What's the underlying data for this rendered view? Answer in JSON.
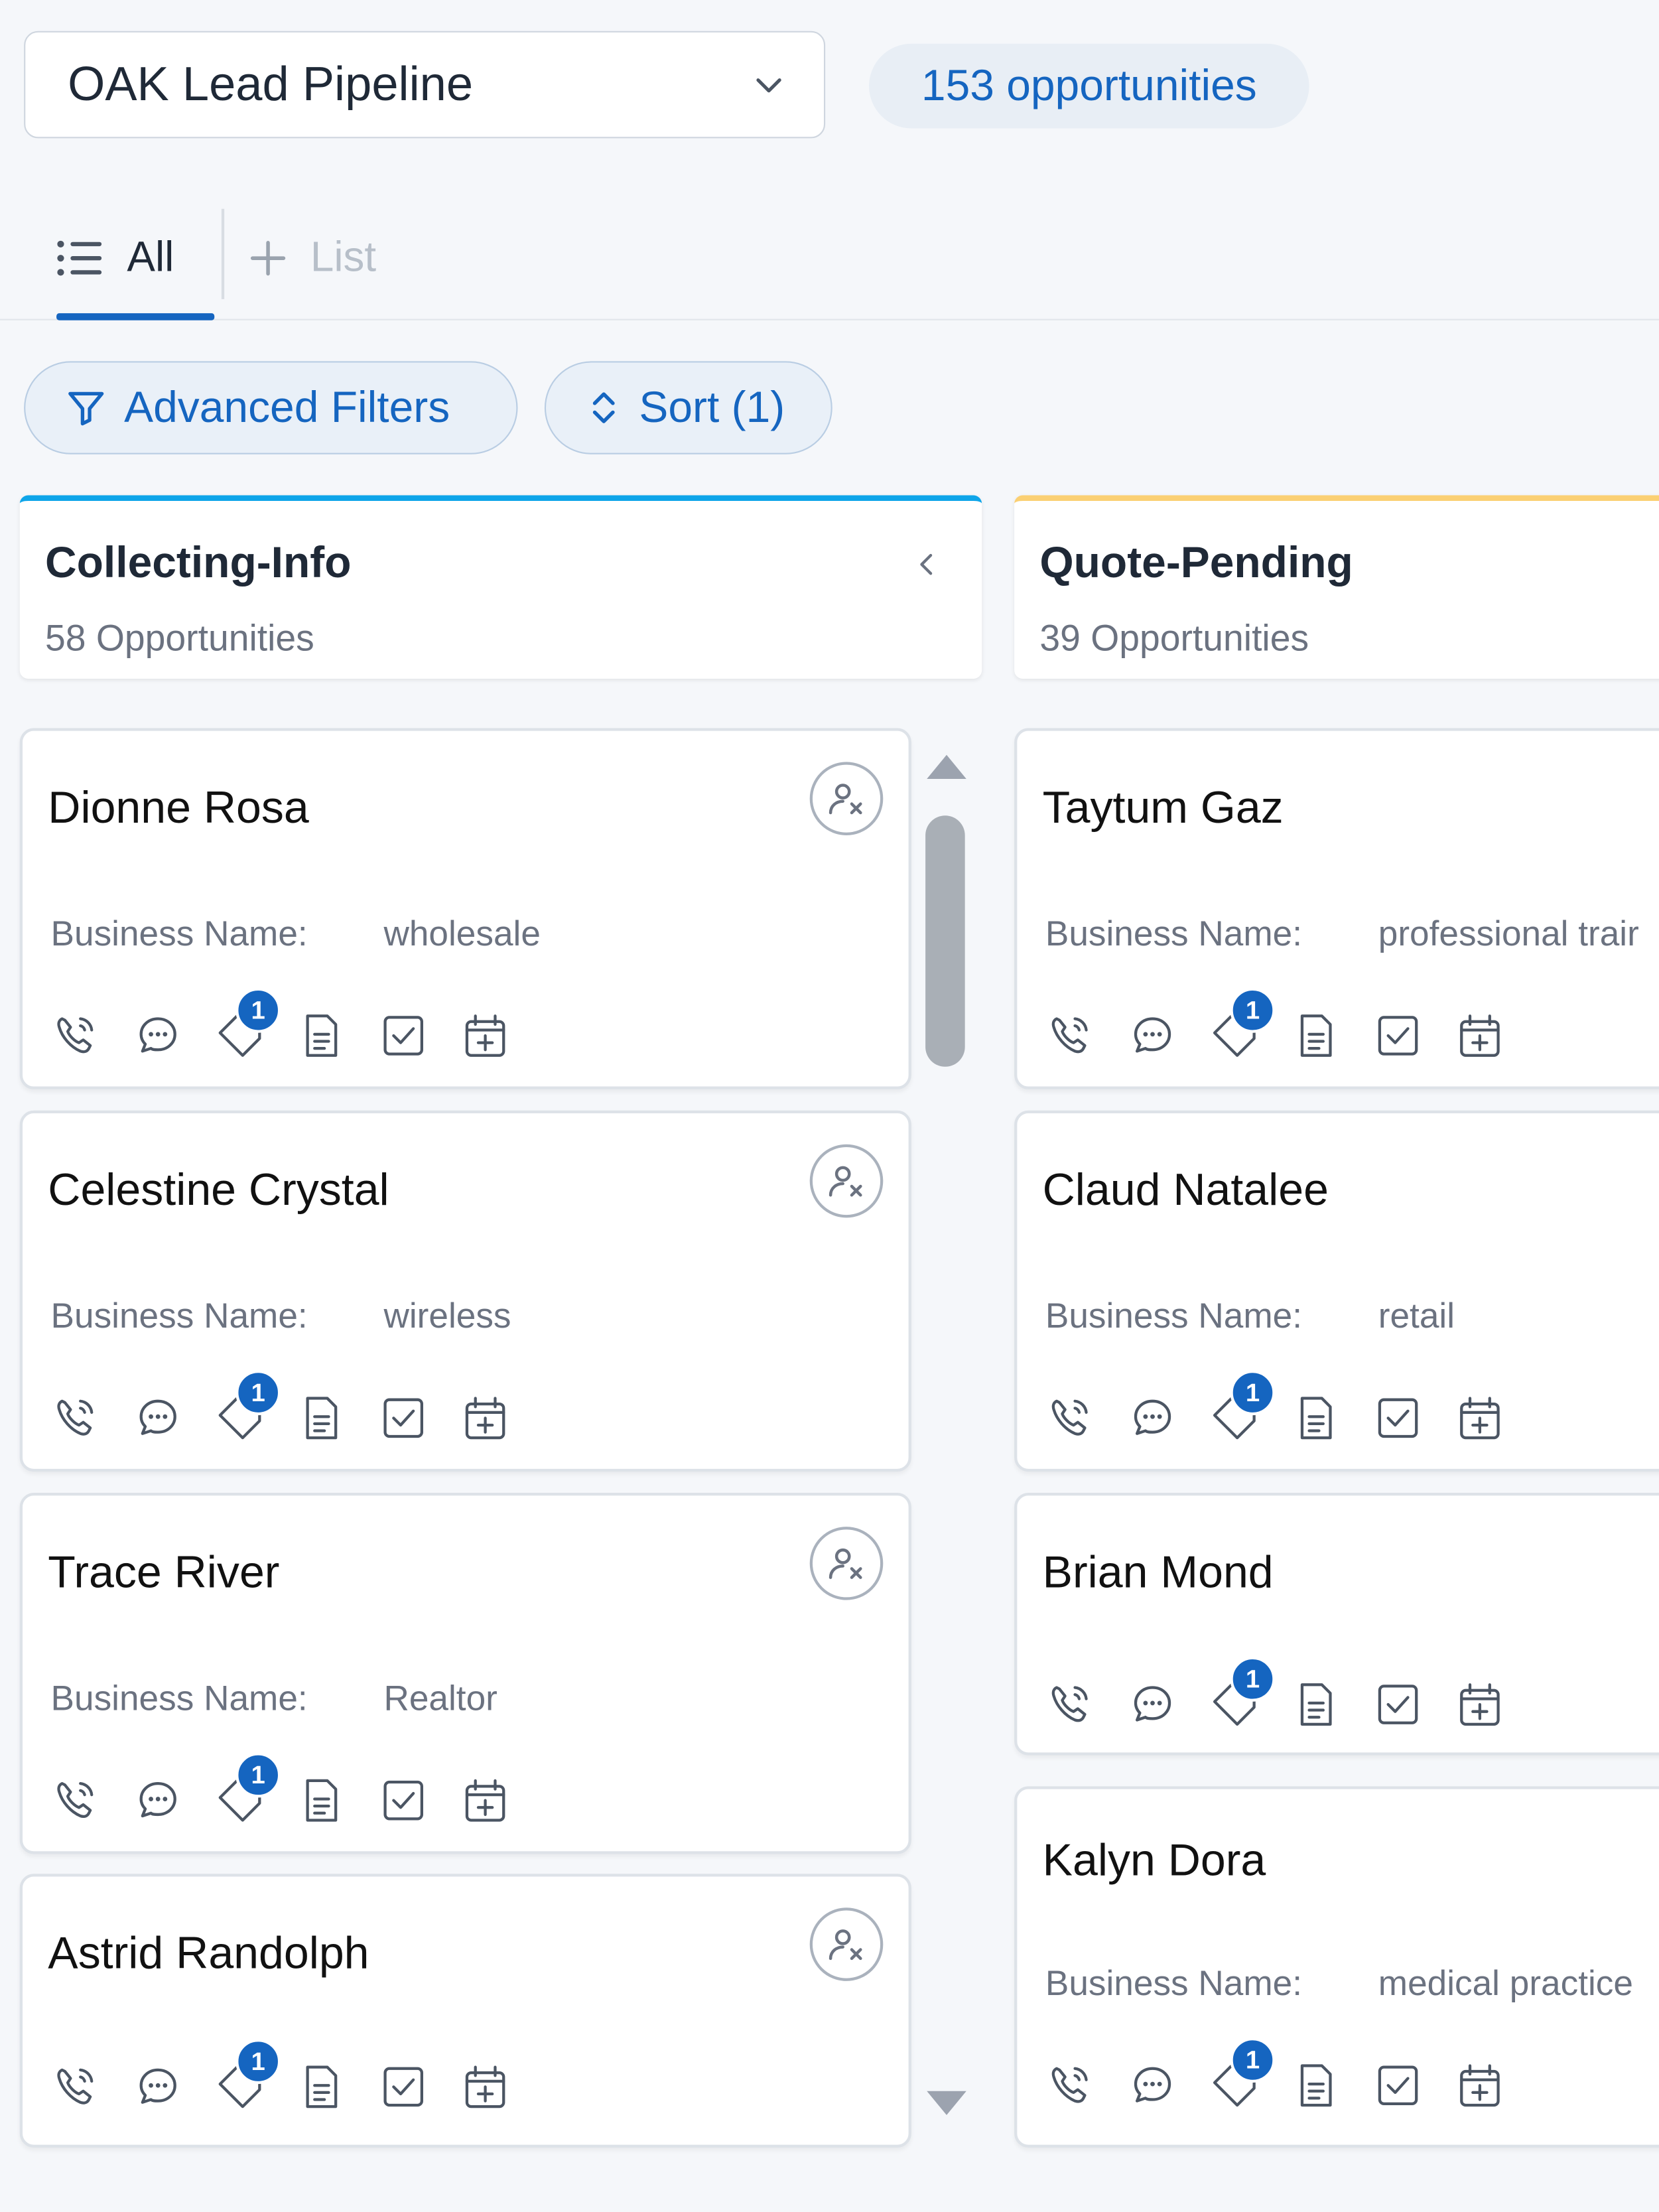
{
  "pipeline": {
    "selected": "OAK Lead Pipeline"
  },
  "opportunity_count": "153 opportunities",
  "tabs": {
    "all_label": "All",
    "add_label": "List"
  },
  "toolbar": {
    "filters_label": "Advanced Filters",
    "sort_label": "Sort (1)"
  },
  "columns": [
    {
      "title": "Collecting-Info",
      "count": "58 Opportunities",
      "accent": "#0ea5e9",
      "cards": [
        {
          "name": "Dionne Rosa",
          "business_label": "Business Name:",
          "business_value": "wholesale",
          "badge": "1"
        },
        {
          "name": "Celestine Crystal",
          "business_label": "Business Name:",
          "business_value": "wireless",
          "badge": "1"
        },
        {
          "name": "Trace River",
          "business_label": "Business Name:",
          "business_value": "Realtor",
          "badge": "1"
        },
        {
          "name": "Astrid Randolph",
          "badge": "1"
        }
      ]
    },
    {
      "title": "Quote-Pending",
      "count": "39 Opportunities",
      "accent": "#fbd073",
      "cards": [
        {
          "name": "Taytum Gaz",
          "business_label": "Business Name:",
          "business_value": "professional trair",
          "badge": "1"
        },
        {
          "name": "Claud Natalee",
          "business_label": "Business Name:",
          "business_value": "retail",
          "badge": "1"
        },
        {
          "name": "Brian Mond",
          "badge": "1"
        },
        {
          "name": "Kalyn Dora",
          "business_label": "Business Name:",
          "business_value": "medical practice",
          "badge": "1"
        }
      ]
    }
  ],
  "icons": [
    "phone-icon",
    "chat-icon",
    "tag-icon",
    "document-icon",
    "task-icon",
    "calendar-add-icon",
    "assign-user-icon"
  ]
}
